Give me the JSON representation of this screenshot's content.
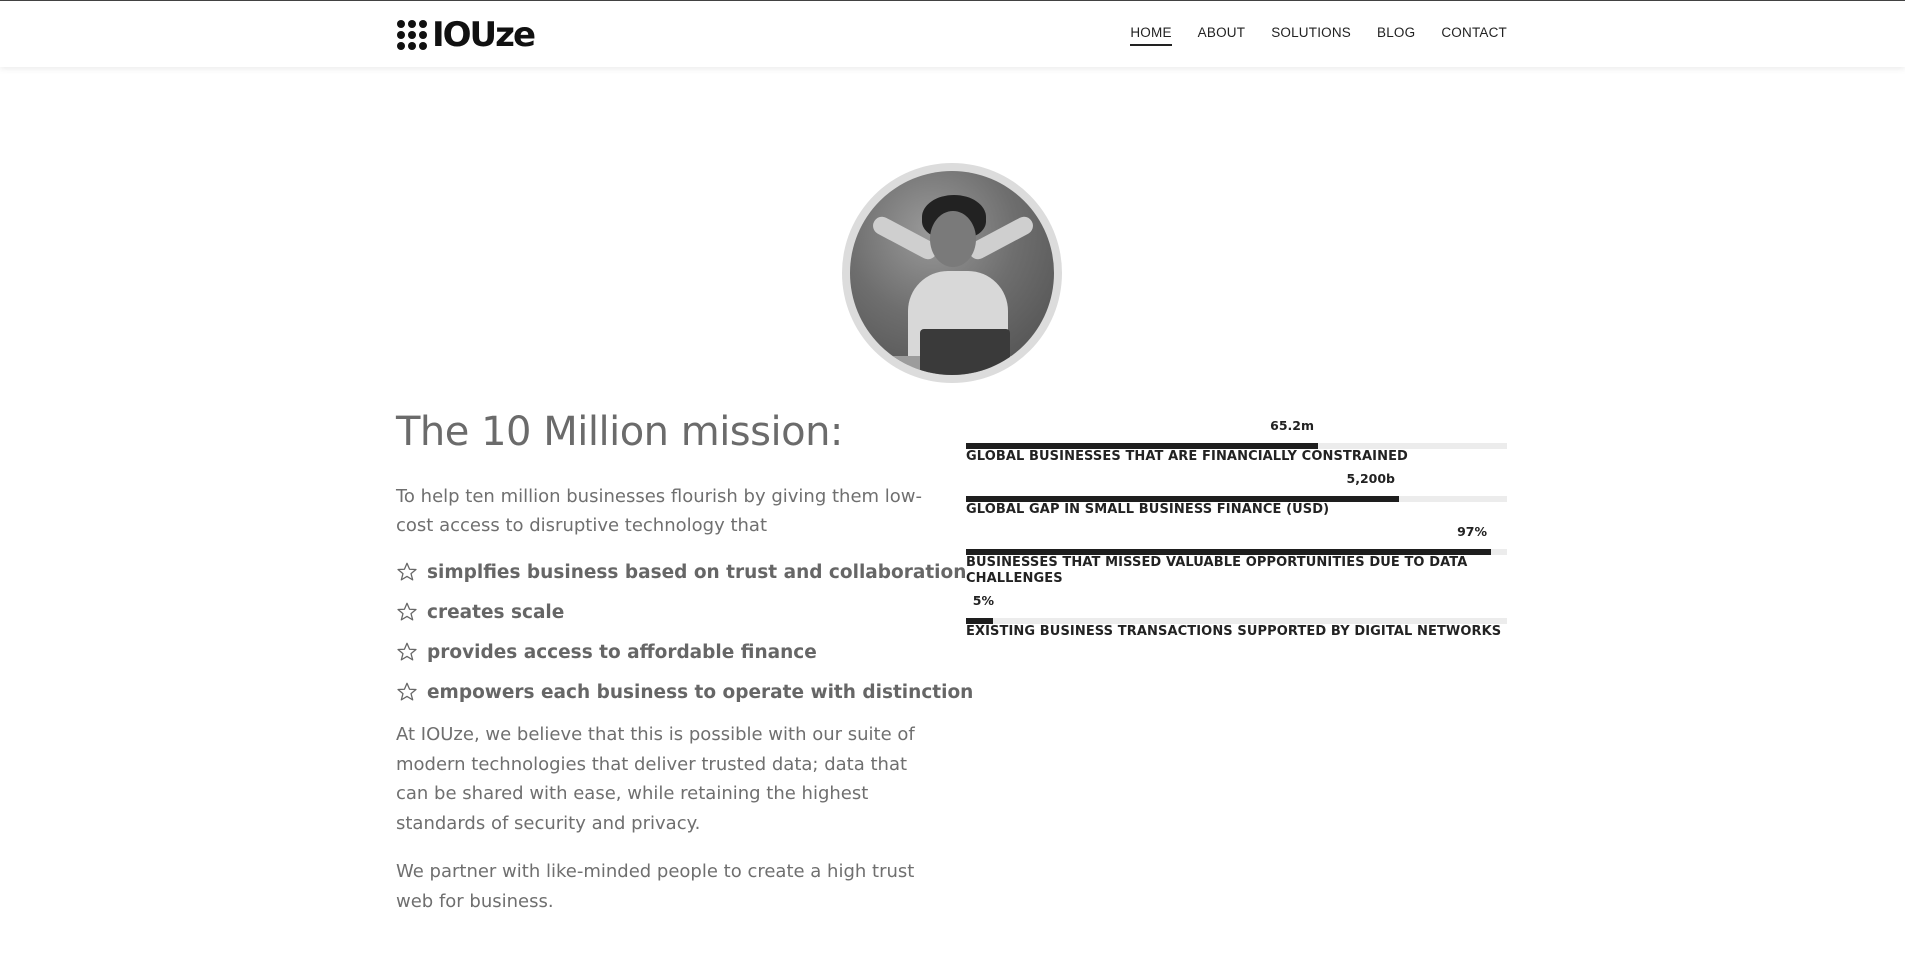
{
  "header": {
    "logo_text": "IOUze",
    "nav": [
      {
        "label": "HOME",
        "active": true
      },
      {
        "label": "ABOUT",
        "active": false
      },
      {
        "label": "SOLUTIONS",
        "active": false
      },
      {
        "label": "BLOG",
        "active": false
      },
      {
        "label": "CONTACT",
        "active": false
      }
    ]
  },
  "hero": {
    "portrait_icon": "woman-relaxing-at-laptop-photo"
  },
  "mission": {
    "title": "The 10 Million mission:",
    "intro": "To help ten million businesses flourish by giving them low-cost access to disruptive technology that",
    "bullets": [
      "simplfies business based on trust and collaboration",
      "creates scale",
      "provides access to affordable finance",
      "empowers each business to operate with distinction"
    ],
    "bullet_icon": "star-outline-icon",
    "paragraph_2": "At IOUze, we believe that this is possible with our suite of modern technologies that deliver trusted data; data that can be shared with ease, while retaining the highest standards of security and privacy.",
    "paragraph_3": "We partner with like-minded people to create a high trust web for business."
  },
  "stats": [
    {
      "value": "65.2m",
      "fill_fraction": 0.65,
      "label": "GLOBAL BUSINESSES THAT ARE FINANCIALLY CONSTRAINED"
    },
    {
      "value": "5,200b",
      "fill_fraction": 0.8,
      "label": "GLOBAL GAP IN SMALL BUSINESS FINANCE (USD)"
    },
    {
      "value": "97%",
      "fill_fraction": 0.97,
      "label": "BUSINESSES THAT MISSED VALUABLE OPPORTUNITIES DUE TO DATA CHALLENGES"
    },
    {
      "value": "5%",
      "fill_fraction": 0.05,
      "label": "EXISTING BUSINESS TRANSACTIONS SUPPORTED BY DIGITAL NETWORKS"
    }
  ],
  "colors": {
    "bar_fill": "#1e1e1e",
    "bar_track": "#ececec",
    "text_gray": "#6b6b6b"
  }
}
